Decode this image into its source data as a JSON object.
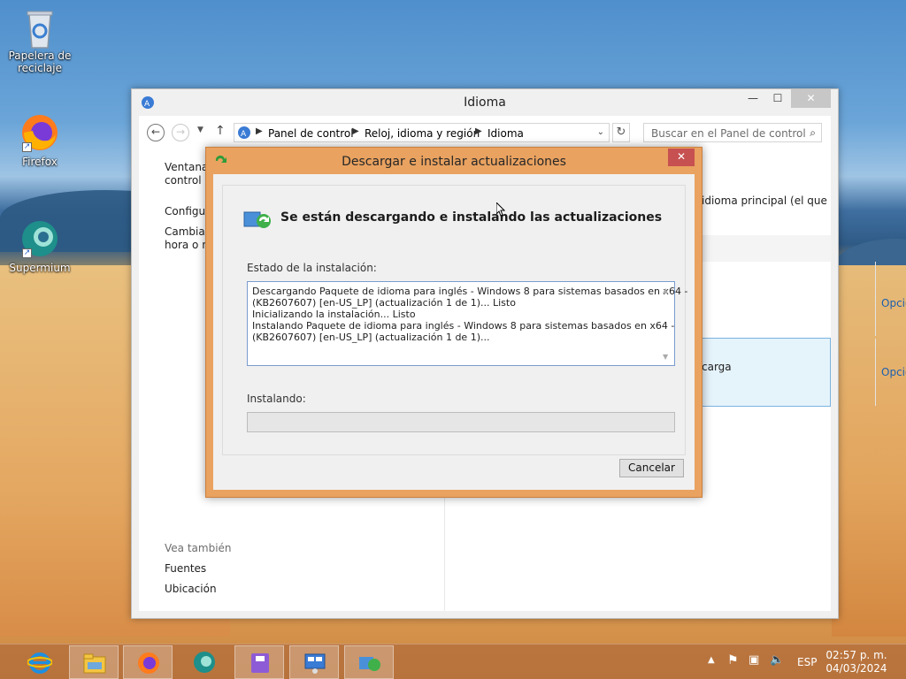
{
  "desktop": {
    "icons": [
      {
        "label": "Papelera de reciclaje"
      },
      {
        "label": "Firefox"
      },
      {
        "label": "Supermium"
      }
    ]
  },
  "cp_window": {
    "title": "Idioma",
    "breadcrumb": [
      "Panel de control",
      "Reloj, idioma y región",
      "Idioma"
    ],
    "search_placeholder": "Buscar en el Panel de control",
    "left_pane": {
      "home_line1": "Ventana",
      "home_line2": "control",
      "config": "Configur",
      "cambiar_line1": "Cambiar",
      "cambiar_line2": "hora o nu",
      "see_also": "Vea también",
      "fonts": "Fuentes",
      "location": "Ubicación"
    },
    "right_pane": {
      "intro_text": "idioma principal (el que",
      "row2_partial": "carga",
      "options_label": "Opciones"
    }
  },
  "dialog": {
    "title": "Descargar e instalar actualizaciones",
    "heading": "Se están descargando e instalando las actualizaciones",
    "status_label": "Estado de la instalación:",
    "log_lines": [
      "Descargando Paquete de idioma para inglés - Windows 8 para sistemas basados en x64 -",
      "(KB2607607) [en-US_LP] (actualización 1 de 1)... Listo",
      "Inicializando la instalación... Listo",
      "Instalando Paquete de idioma para inglés - Windows 8 para sistemas basados en x64 -",
      "(KB2607607) [en-US_LP] (actualización 1 de 1)..."
    ],
    "installing_label": "Instalando:",
    "progress": 0,
    "cancel_label": "Cancelar"
  },
  "taskbar": {
    "language": "ESP",
    "time": "02:57 p. m.",
    "date": "04/03/2024"
  }
}
